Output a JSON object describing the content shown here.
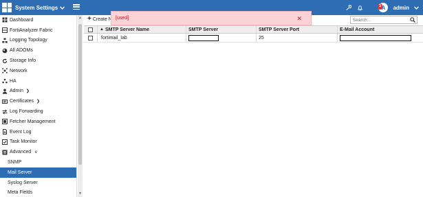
{
  "topbar": {
    "title": "System Settings",
    "notification_count": "1",
    "avatar_initial": "A",
    "user_label": "admin",
    "accent_color": "#2e6cb4"
  },
  "sidebar": {
    "items": [
      {
        "label": "Dashboard",
        "icon": "dashboard-icon"
      },
      {
        "label": "FortiAnalyzer Fabric",
        "icon": "fabric-icon"
      },
      {
        "label": "Logging Topology",
        "icon": "topology-icon"
      },
      {
        "label": "All ADOMs",
        "icon": "globe-icon"
      },
      {
        "label": "Storage Info",
        "icon": "refresh-icon"
      },
      {
        "label": "Network",
        "icon": "network-icon"
      },
      {
        "label": "HA",
        "icon": "ha-icon"
      },
      {
        "label": "Admin",
        "icon": "user-icon"
      },
      {
        "label": "Certificates",
        "icon": "certificate-icon"
      },
      {
        "label": "Log Forwarding",
        "icon": "forward-icon"
      },
      {
        "label": "Fetcher Management",
        "icon": "fetcher-icon"
      },
      {
        "label": "Event Log",
        "icon": "document-icon"
      },
      {
        "label": "Task Monitor",
        "icon": "monitor-icon"
      },
      {
        "label": "Advanced",
        "icon": "advanced-icon"
      },
      {
        "label": "SNMP"
      },
      {
        "label": "Mail Server"
      },
      {
        "label": "Syslog Server"
      },
      {
        "label": "Meta Fields"
      }
    ]
  },
  "toolbar": {
    "create_label": "Create N",
    "search_placeholder": "Search..."
  },
  "table": {
    "columns": [
      "SMTP Server Name",
      "SMTP Server",
      "SMTP Server Port",
      "E-Mail Account"
    ],
    "rows": [
      {
        "name": "fortimail_lab",
        "server": "",
        "port": "25",
        "account": ""
      }
    ]
  },
  "alert": {
    "message": "[used]"
  }
}
